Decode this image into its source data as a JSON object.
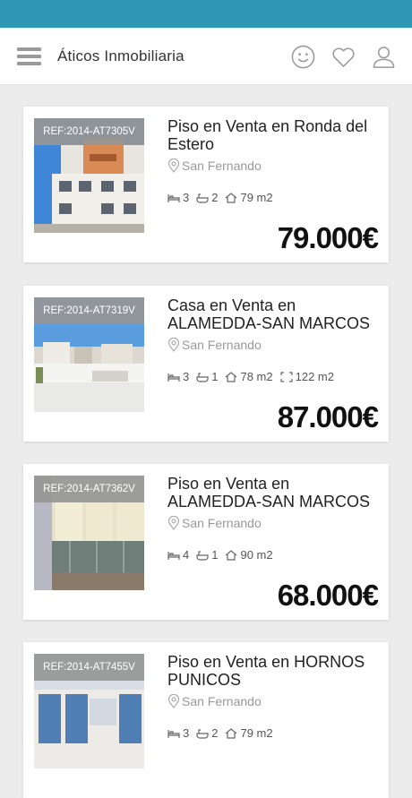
{
  "header": {
    "title": "Áticos Inmobiliaria",
    "icons": [
      "menu-icon",
      "smiley-icon",
      "heart-icon",
      "user-icon"
    ]
  },
  "listings": [
    {
      "ref": "REF:2014-AT7305V",
      "title": "Piso en Venta en Ronda del Estero",
      "location": "San Fernando",
      "beds": "3",
      "baths": "2",
      "built_area": "79 m2",
      "plot_area": "",
      "price": "79.000€"
    },
    {
      "ref": "REF:2014-AT7319V",
      "title": "Casa en Venta en ALAMEDDA-SAN MARCOS",
      "location": "San Fernando",
      "beds": "3",
      "baths": "1",
      "built_area": "78 m2",
      "plot_area": "122 m2",
      "price": "87.000€"
    },
    {
      "ref": "REF:2014-AT7362V",
      "title": "Piso en Venta en ALAMEDDA-SAN MARCOS",
      "location": "San Fernando",
      "beds": "4",
      "baths": "1",
      "built_area": "90 m2",
      "plot_area": "",
      "price": "68.000€"
    },
    {
      "ref": "REF:2014-AT7455V",
      "title": "Piso en Venta en HORNOS PUNICOS",
      "location": "San Fernando",
      "beds": "3",
      "baths": "2",
      "built_area": "79 m2",
      "plot_area": "",
      "price": ""
    }
  ]
}
